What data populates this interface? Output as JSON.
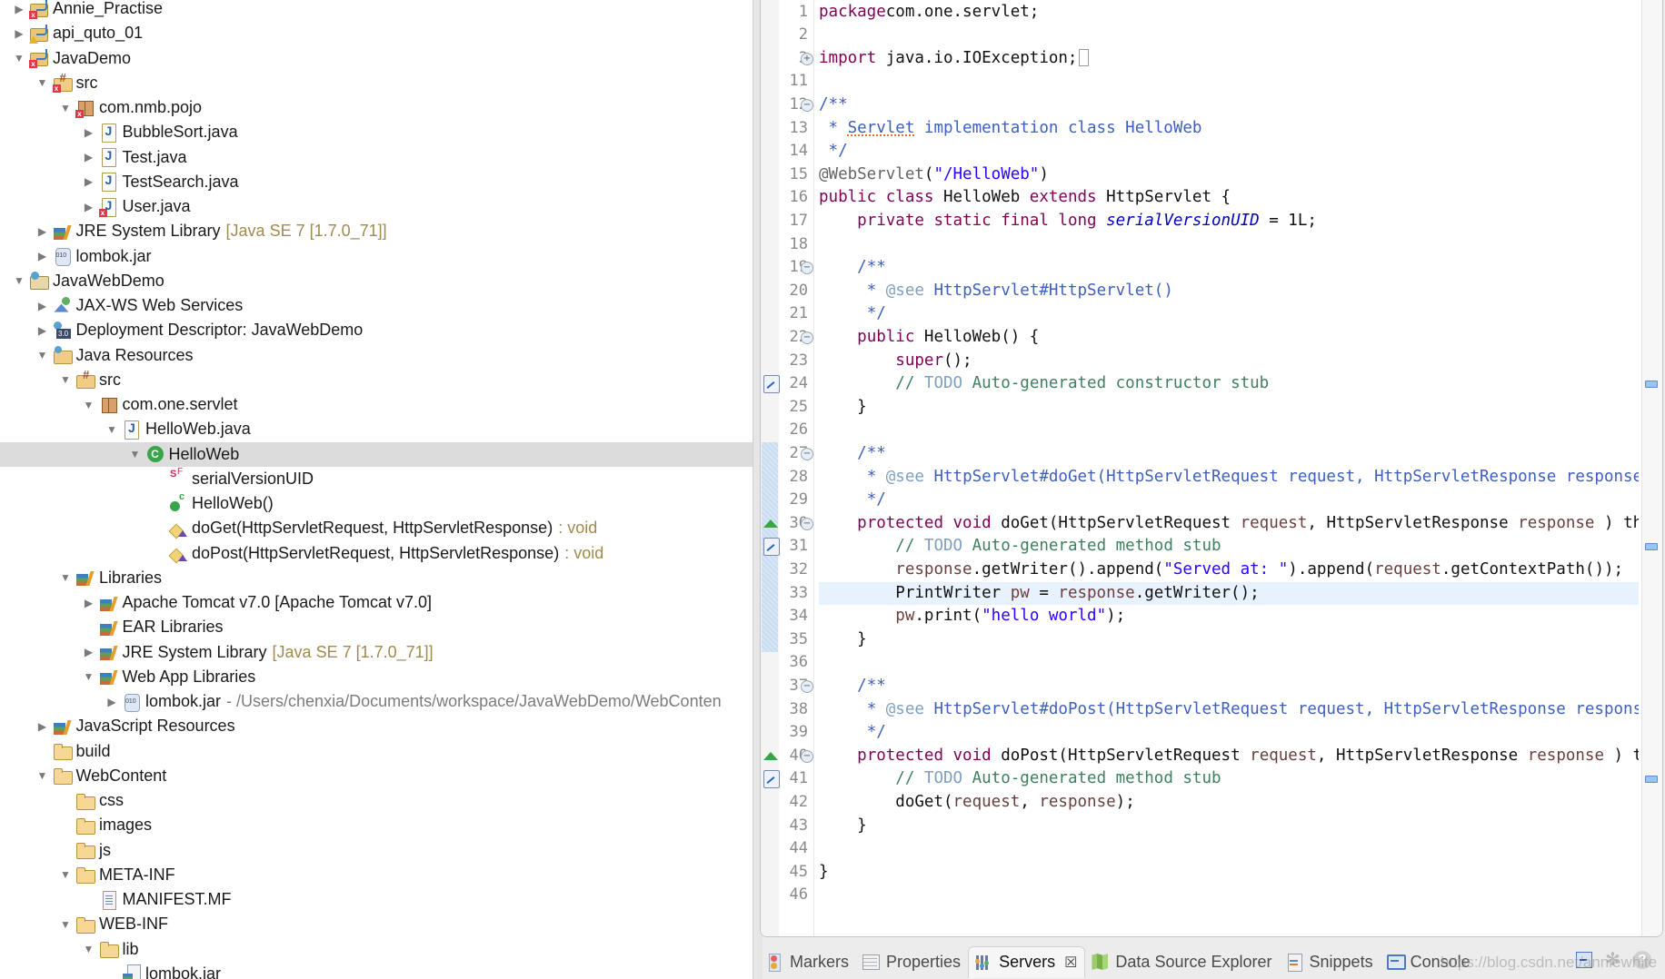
{
  "project_explorer": {
    "rows": [
      {
        "depth": 0,
        "twisty": "collapsed",
        "icon": "project",
        "badge": "error",
        "label": "Annie_Practise",
        "decoration": ""
      },
      {
        "depth": 0,
        "twisty": "collapsed",
        "icon": "project",
        "badge": "warning",
        "label": "api_quto_01",
        "decoration": ""
      },
      {
        "depth": 0,
        "twisty": "expanded",
        "icon": "project",
        "badge": "error",
        "label": "JavaDemo",
        "decoration": ""
      },
      {
        "depth": 1,
        "twisty": "expanded",
        "icon": "srcfolder",
        "badge": "error",
        "label": "src",
        "decoration": ""
      },
      {
        "depth": 2,
        "twisty": "expanded",
        "icon": "package",
        "badge": "error",
        "label": "com.nmb.pojo",
        "decoration": ""
      },
      {
        "depth": 3,
        "twisty": "collapsed",
        "icon": "java",
        "badge": "",
        "label": "BubbleSort.java",
        "decoration": ""
      },
      {
        "depth": 3,
        "twisty": "collapsed",
        "icon": "java",
        "badge": "",
        "label": "Test.java",
        "decoration": ""
      },
      {
        "depth": 3,
        "twisty": "collapsed",
        "icon": "java",
        "badge": "",
        "label": "TestSearch.java",
        "decoration": ""
      },
      {
        "depth": 3,
        "twisty": "collapsed",
        "icon": "java",
        "badge": "error",
        "label": "User.java",
        "decoration": ""
      },
      {
        "depth": 1,
        "twisty": "collapsed",
        "icon": "lib",
        "badge": "",
        "label": "JRE System Library",
        "decoration": "[Java SE 7 [1.7.0_71]]"
      },
      {
        "depth": 1,
        "twisty": "collapsed",
        "icon": "jar",
        "badge": "",
        "label": "lombok.jar",
        "decoration": ""
      },
      {
        "depth": 0,
        "twisty": "expanded",
        "icon": "webproject",
        "badge": "",
        "label": "JavaWebDemo",
        "decoration": ""
      },
      {
        "depth": 1,
        "twisty": "collapsed",
        "icon": "webservice",
        "badge": "",
        "label": "JAX-WS Web Services",
        "decoration": ""
      },
      {
        "depth": 1,
        "twisty": "collapsed",
        "icon": "dd",
        "badge": "",
        "label": "Deployment Descriptor: JavaWebDemo",
        "decoration": ""
      },
      {
        "depth": 1,
        "twisty": "expanded",
        "icon": "jres",
        "badge": "",
        "label": "Java Resources",
        "decoration": ""
      },
      {
        "depth": 2,
        "twisty": "expanded",
        "icon": "srcfolder",
        "badge": "",
        "label": "src",
        "decoration": ""
      },
      {
        "depth": 3,
        "twisty": "expanded",
        "icon": "package",
        "badge": "",
        "label": "com.one.servlet",
        "decoration": ""
      },
      {
        "depth": 4,
        "twisty": "expanded",
        "icon": "java",
        "badge": "",
        "label": "HelloWeb.java",
        "decoration": ""
      },
      {
        "depth": 5,
        "twisty": "expanded",
        "icon": "class",
        "badge": "",
        "label": "HelloWeb",
        "decoration": "",
        "selected": true
      },
      {
        "depth": 6,
        "twisty": "none",
        "icon": "field",
        "badge": "",
        "label": "serialVersionUID",
        "decoration": ""
      },
      {
        "depth": 6,
        "twisty": "none",
        "icon": "ctor",
        "badge": "",
        "label": "HelloWeb()",
        "decoration": ""
      },
      {
        "depth": 6,
        "twisty": "none",
        "icon": "method",
        "badge": "",
        "label": "doGet(HttpServletRequest, HttpServletResponse)",
        "decoration": ": void"
      },
      {
        "depth": 6,
        "twisty": "none",
        "icon": "method",
        "badge": "",
        "label": "doPost(HttpServletRequest, HttpServletResponse)",
        "decoration": ": void"
      },
      {
        "depth": 2,
        "twisty": "expanded",
        "icon": "lib",
        "badge": "",
        "label": "Libraries",
        "decoration": ""
      },
      {
        "depth": 3,
        "twisty": "collapsed",
        "icon": "lib",
        "badge": "",
        "label": "Apache Tomcat v7.0 [Apache Tomcat v7.0]",
        "decoration": ""
      },
      {
        "depth": 3,
        "twisty": "none",
        "icon": "lib",
        "badge": "",
        "label": "EAR Libraries",
        "decoration": ""
      },
      {
        "depth": 3,
        "twisty": "collapsed",
        "icon": "lib",
        "badge": "",
        "label": "JRE System Library",
        "decoration": "[Java SE 7 [1.7.0_71]]"
      },
      {
        "depth": 3,
        "twisty": "expanded",
        "icon": "lib",
        "badge": "",
        "label": "Web App Libraries",
        "decoration": ""
      },
      {
        "depth": 4,
        "twisty": "collapsed",
        "icon": "jar",
        "badge": "",
        "label": "lombok.jar",
        "decoration": "- /Users/chenxia/Documents/workspace/JavaWebDemo/WebConten",
        "decoration_style": "path"
      },
      {
        "depth": 1,
        "twisty": "collapsed",
        "icon": "lib",
        "badge": "",
        "label": "JavaScript Resources",
        "decoration": ""
      },
      {
        "depth": 1,
        "twisty": "none",
        "icon": "folder",
        "badge": "",
        "label": "build",
        "decoration": ""
      },
      {
        "depth": 1,
        "twisty": "expanded",
        "icon": "folder",
        "badge": "",
        "label": "WebContent",
        "decoration": ""
      },
      {
        "depth": 2,
        "twisty": "none",
        "icon": "folder",
        "badge": "",
        "label": "css",
        "decoration": ""
      },
      {
        "depth": 2,
        "twisty": "none",
        "icon": "folder",
        "badge": "",
        "label": "images",
        "decoration": ""
      },
      {
        "depth": 2,
        "twisty": "none",
        "icon": "folder",
        "badge": "",
        "label": "js",
        "decoration": ""
      },
      {
        "depth": 2,
        "twisty": "expanded",
        "icon": "folder",
        "badge": "",
        "label": "META-INF",
        "decoration": ""
      },
      {
        "depth": 3,
        "twisty": "none",
        "icon": "file",
        "badge": "",
        "label": "MANIFEST.MF",
        "decoration": ""
      },
      {
        "depth": 2,
        "twisty": "expanded",
        "icon": "folder",
        "badge": "",
        "label": "WEB-INF",
        "decoration": ""
      },
      {
        "depth": 3,
        "twisty": "expanded",
        "icon": "folder",
        "badge": "",
        "label": "lib",
        "decoration": ""
      },
      {
        "depth": 4,
        "twisty": "none",
        "icon": "jarfile",
        "badge": "",
        "label": "lombok.jar",
        "decoration": ""
      }
    ]
  },
  "editor": {
    "current_line": 33,
    "lines": [
      {
        "n": "1",
        "tokens": [
          [
            "kw",
            "package"
          ],
          [
            "",
            "com.one.servlet;"
          ]
        ]
      },
      {
        "n": "2",
        "tokens": []
      },
      {
        "n": "3",
        "fold": "plus",
        "tokens": [
          [
            "kw",
            "import"
          ],
          [
            "",
            " java.io.IOException;"
          ]
        ],
        "folded_box": true
      },
      {
        "n": "11",
        "tokens": []
      },
      {
        "n": "12",
        "fold": "minus",
        "tokens": [
          [
            "jd",
            "/**"
          ]
        ]
      },
      {
        "n": "13",
        "tokens": [
          [
            "jd",
            " * "
          ],
          [
            "jd spell",
            "Servlet"
          ],
          [
            "jd",
            " implementation class HelloWeb"
          ]
        ]
      },
      {
        "n": "14",
        "tokens": [
          [
            "jd",
            " */"
          ]
        ]
      },
      {
        "n": "15",
        "tokens": [
          [
            "ann",
            "@WebServlet"
          ],
          [
            "",
            "("
          ],
          [
            "str",
            "\"/HelloWeb\""
          ],
          [
            "",
            ")"
          ]
        ]
      },
      {
        "n": "16",
        "tokens": [
          [
            "kw",
            "public class"
          ],
          [
            "",
            " HelloWeb "
          ],
          [
            "kw",
            "extends"
          ],
          [
            "",
            " HttpServlet {"
          ]
        ]
      },
      {
        "n": "17",
        "tokens": [
          [
            "",
            "    "
          ],
          [
            "kw",
            "private static final long"
          ],
          [
            "",
            " "
          ],
          [
            "fieldit",
            "serialVersionUID"
          ],
          [
            "",
            " = 1L;"
          ]
        ]
      },
      {
        "n": "18",
        "tokens": []
      },
      {
        "n": "19",
        "fold": "minus",
        "tokens": [
          [
            "",
            "    "
          ],
          [
            "jd",
            "/**"
          ]
        ]
      },
      {
        "n": "20",
        "tokens": [
          [
            "",
            "    "
          ],
          [
            "jd",
            " * "
          ],
          [
            "jdtag",
            "@see"
          ],
          [
            "jd",
            " HttpServlet#HttpServlet()"
          ]
        ]
      },
      {
        "n": "21",
        "tokens": [
          [
            "",
            "    "
          ],
          [
            "jd",
            " */"
          ]
        ]
      },
      {
        "n": "22",
        "fold": "minus",
        "tokens": [
          [
            "",
            "    "
          ],
          [
            "kw",
            "public"
          ],
          [
            "",
            " HelloWeb() {"
          ]
        ]
      },
      {
        "n": "23",
        "tokens": [
          [
            "",
            "        "
          ],
          [
            "kw",
            "super"
          ],
          [
            "",
            "();"
          ]
        ]
      },
      {
        "n": "24",
        "marker": "task",
        "overview": true,
        "tokens": [
          [
            "",
            "        "
          ],
          [
            "cm",
            "// "
          ],
          [
            "todo",
            "TODO"
          ],
          [
            "cm",
            " Auto-generated constructor stub"
          ]
        ]
      },
      {
        "n": "25",
        "tokens": [
          [
            "",
            "    }"
          ]
        ]
      },
      {
        "n": "26",
        "tokens": []
      },
      {
        "n": "27",
        "fold": "minus",
        "tokens": [
          [
            "",
            "    "
          ],
          [
            "jd",
            "/**"
          ]
        ]
      },
      {
        "n": "28",
        "tokens": [
          [
            "",
            "    "
          ],
          [
            "jd",
            " * "
          ],
          [
            "jdtag",
            "@see"
          ],
          [
            "jd",
            " HttpServlet#doGet(HttpServletRequest request, HttpServletResponse response)"
          ]
        ]
      },
      {
        "n": "29",
        "tokens": [
          [
            "",
            "    "
          ],
          [
            "jd",
            " */"
          ]
        ]
      },
      {
        "n": "30",
        "fold": "minus",
        "marker": "override",
        "tokens": [
          [
            "",
            "    "
          ],
          [
            "kw",
            "protected void"
          ],
          [
            "",
            " doGet(HttpServletRequest "
          ],
          [
            "var",
            "request"
          ],
          [
            "",
            ", HttpServletResponse "
          ],
          [
            "var",
            "response"
          ],
          [
            "",
            " ) throws ServletException, IOException {"
          ]
        ]
      },
      {
        "n": "31",
        "marker": "task",
        "overview": true,
        "tokens": [
          [
            "",
            "        "
          ],
          [
            "cm",
            "// "
          ],
          [
            "todo",
            "TODO"
          ],
          [
            "cm",
            " Auto-generated method stub"
          ]
        ]
      },
      {
        "n": "32",
        "tokens": [
          [
            "",
            "        "
          ],
          [
            "var",
            "response"
          ],
          [
            "",
            ".getWriter().append("
          ],
          [
            "str",
            "\"Served at: \""
          ],
          [
            "",
            ").append("
          ],
          [
            "var",
            "request"
          ],
          [
            "",
            ".getContextPath());"
          ]
        ]
      },
      {
        "n": "33",
        "tokens": [
          [
            "",
            "        PrintWriter "
          ],
          [
            "var",
            "pw"
          ],
          [
            "",
            " = "
          ],
          [
            "var",
            "response"
          ],
          [
            "",
            ".getWriter();"
          ]
        ]
      },
      {
        "n": "34",
        "tokens": [
          [
            "",
            "        "
          ],
          [
            "var",
            "pw"
          ],
          [
            "",
            ".print("
          ],
          [
            "str",
            "\"hello world\""
          ],
          [
            "",
            ");"
          ]
        ]
      },
      {
        "n": "35",
        "tokens": [
          [
            "",
            "    }"
          ]
        ]
      },
      {
        "n": "36",
        "tokens": []
      },
      {
        "n": "37",
        "fold": "minus",
        "tokens": [
          [
            "",
            "    "
          ],
          [
            "jd",
            "/**"
          ]
        ]
      },
      {
        "n": "38",
        "tokens": [
          [
            "",
            "    "
          ],
          [
            "jd",
            " * "
          ],
          [
            "jdtag",
            "@see"
          ],
          [
            "jd",
            " HttpServlet#doPost(HttpServletRequest request, HttpServletResponse response)"
          ]
        ]
      },
      {
        "n": "39",
        "tokens": [
          [
            "",
            "    "
          ],
          [
            "jd",
            " */"
          ]
        ]
      },
      {
        "n": "40",
        "fold": "minus",
        "marker": "override",
        "tokens": [
          [
            "",
            "    "
          ],
          [
            "kw",
            "protected void"
          ],
          [
            "",
            " doPost(HttpServletRequest "
          ],
          [
            "var",
            "request"
          ],
          [
            "",
            ", HttpServletResponse "
          ],
          [
            "var",
            "response"
          ],
          [
            "",
            " ) throws ServletException, IOException {"
          ]
        ]
      },
      {
        "n": "41",
        "marker": "task",
        "overview": true,
        "tokens": [
          [
            "",
            "        "
          ],
          [
            "cm",
            "// "
          ],
          [
            "todo",
            "TODO"
          ],
          [
            "cm",
            " Auto-generated method stub"
          ]
        ]
      },
      {
        "n": "42",
        "tokens": [
          [
            "",
            "        doGet("
          ],
          [
            "var",
            "request"
          ],
          [
            "",
            ", "
          ],
          [
            "var",
            "response"
          ],
          [
            "",
            ");"
          ]
        ]
      },
      {
        "n": "43",
        "tokens": [
          [
            "",
            "    }"
          ]
        ]
      },
      {
        "n": "44",
        "tokens": []
      },
      {
        "n": "45",
        "tokens": [
          [
            "",
            "}"
          ]
        ]
      },
      {
        "n": "46",
        "tokens": []
      }
    ]
  },
  "bottom_tabs": [
    {
      "id": "markers",
      "label": "Markers",
      "icon": "markers"
    },
    {
      "id": "properties",
      "label": "Properties",
      "icon": "props"
    },
    {
      "id": "servers",
      "label": "Servers",
      "icon": "servers",
      "active": true,
      "close": "☒"
    },
    {
      "id": "data-source-explorer",
      "label": "Data Source Explorer",
      "icon": "dse"
    },
    {
      "id": "snippets",
      "label": "Snippets",
      "icon": "snip"
    },
    {
      "id": "console",
      "label": "Console",
      "icon": "console"
    }
  ],
  "watermark": "https://blog.csdn.net/anniewhite"
}
